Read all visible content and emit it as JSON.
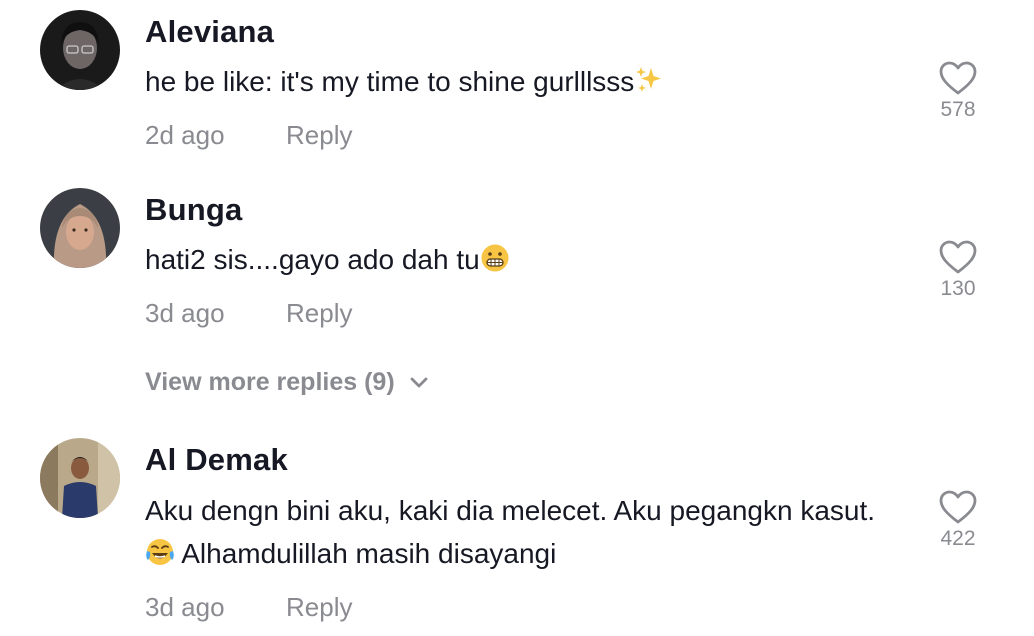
{
  "comments": [
    {
      "username": "Aleviana",
      "text": "he be like: it's my time to shine gurlllsss",
      "emoji": "sparkles-emoji",
      "time": "2d ago",
      "reply": "Reply",
      "likes": "578"
    },
    {
      "username": "Bunga",
      "text": "hati2 sis....gayo ado dah tu",
      "emoji": "grimacing-face-emoji",
      "time": "3d ago",
      "reply": "Reply",
      "likes": "130",
      "view_more": "View more replies (9)"
    },
    {
      "username": "Al Demak",
      "text_before": "Aku dengn bini aku, kaki dia melecet. Aku pegangkn kasut.",
      "emoji": "face-with-tears-of-joy-emoji",
      "text_after": "Alhamdulillah masih disayangi",
      "time": "3d ago",
      "reply": "Reply",
      "likes": "422"
    }
  ],
  "colors": {
    "primary_text": "#161823",
    "secondary_text": "#8a8b91",
    "background": "#ffffff"
  }
}
